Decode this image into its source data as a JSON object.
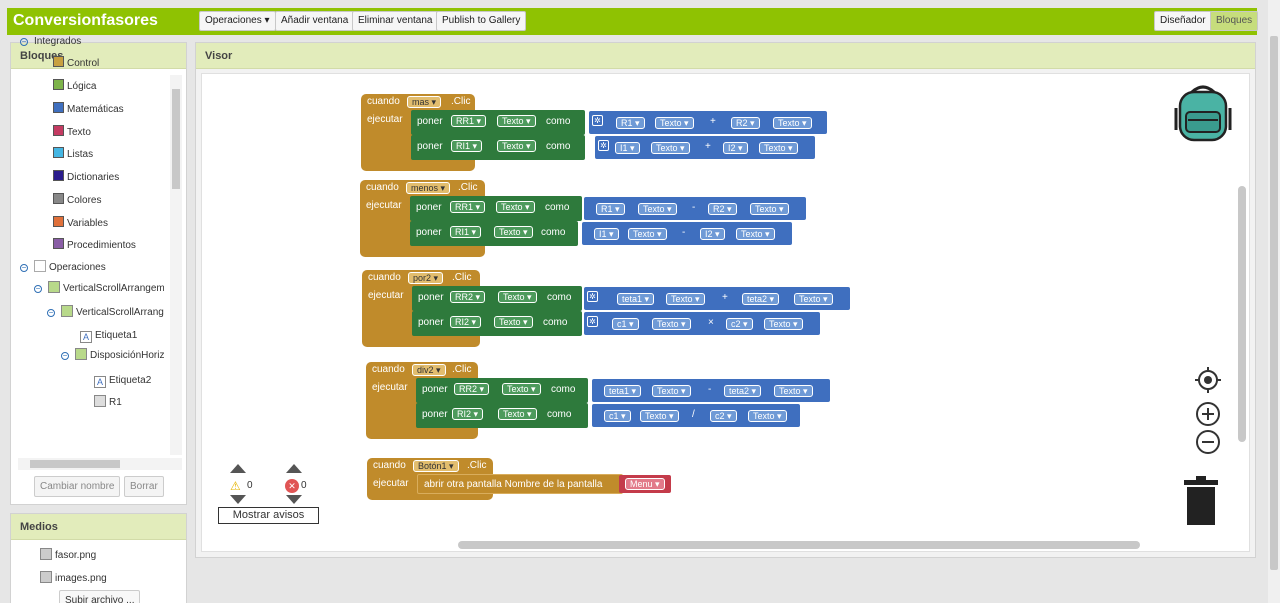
{
  "app": {
    "title": "Conversionfasores"
  },
  "toolbar": {
    "operaciones": "Operaciones ▾",
    "add_window": "Añadir ventana",
    "delete_window": "Eliminar ventana",
    "publish": "Publish to Gallery",
    "designer": "Diseñador",
    "blocks": "Bloques"
  },
  "blocks_panel": {
    "title": "Bloques",
    "tree": [
      {
        "label": "Integrados",
        "kind": "expander"
      },
      {
        "label": "Control",
        "color": "#c8a040"
      },
      {
        "label": "Lógica",
        "color": "#7db34a"
      },
      {
        "label": "Matemáticas",
        "color": "#3f6fbf"
      },
      {
        "label": "Texto",
        "color": "#c43b62"
      },
      {
        "label": "Listas",
        "color": "#44b6e3"
      },
      {
        "label": "Dictionaries",
        "color": "#2a1b8c"
      },
      {
        "label": "Colores",
        "color": "#888888"
      },
      {
        "label": "Variables",
        "color": "#e0703a"
      },
      {
        "label": "Procedimientos",
        "color": "#8a5ea6"
      },
      {
        "label": "Operaciones",
        "kind": "expander"
      },
      {
        "label": "VerticalScrollArrangem",
        "kind": "component"
      },
      {
        "label": "VerticalScrollArrang",
        "kind": "component"
      },
      {
        "label": "Etiqueta1",
        "kind": "component"
      },
      {
        "label": "DisposiciónHoriz",
        "kind": "component"
      },
      {
        "label": "Etiqueta2",
        "kind": "component"
      },
      {
        "label": "R1",
        "kind": "component"
      }
    ],
    "rename_button": "Cambiar nombre",
    "delete_button": "Borrar"
  },
  "media_panel": {
    "title": "Medios",
    "files": [
      "fasor.png",
      "images.png"
    ],
    "upload_button": "Subir archivo ..."
  },
  "viewer": {
    "title": "Visor",
    "warnings_count": "0",
    "errors_count": "0",
    "show_warnings": "Mostrar avisos"
  },
  "blocks": {
    "b1": {
      "when": "cuando",
      "comp": "mas",
      "event": ".Clic",
      "do": "ejecutar",
      "rows": [
        {
          "set": "poner",
          "var": "RR1",
          "prop": "Texto",
          "to": "como",
          "a": "R1",
          "ap": "Texto",
          "op": "+",
          "b": "R2",
          "bp": "Texto"
        },
        {
          "set": "poner",
          "var": "RI1",
          "prop": "Texto",
          "to": "como",
          "a": "I1",
          "ap": "Texto",
          "op": "+",
          "b": "I2",
          "bp": "Texto"
        }
      ]
    },
    "b2": {
      "when": "cuando",
      "comp": "menos",
      "event": ".Clic",
      "do": "ejecutar",
      "rows": [
        {
          "set": "poner",
          "var": "RR1",
          "prop": "Texto",
          "to": "como",
          "a": "R1",
          "ap": "Texto",
          "op": "-",
          "b": "R2",
          "bp": "Texto"
        },
        {
          "set": "poner",
          "var": "RI1",
          "prop": "Texto",
          "to": "como",
          "a": "I1",
          "ap": "Texto",
          "op": "-",
          "b": "I2",
          "bp": "Texto"
        }
      ]
    },
    "b3": {
      "when": "cuando",
      "comp": "por2",
      "event": ".Clic",
      "do": "ejecutar",
      "rows": [
        {
          "set": "poner",
          "var": "RR2",
          "prop": "Texto",
          "to": "como",
          "a": "teta1",
          "ap": "Texto",
          "op": "+",
          "b": "teta2",
          "bp": "Texto"
        },
        {
          "set": "poner",
          "var": "RI2",
          "prop": "Texto",
          "to": "como",
          "a": "c1",
          "ap": "Texto",
          "op": "×",
          "b": "c2",
          "bp": "Texto"
        }
      ]
    },
    "b4": {
      "when": "cuando",
      "comp": "div2",
      "event": ".Clic",
      "do": "ejecutar",
      "rows": [
        {
          "set": "poner",
          "var": "RR2",
          "prop": "Texto",
          "to": "como",
          "a": "teta1",
          "ap": "Texto",
          "op": "-",
          "b": "teta2",
          "bp": "Texto"
        },
        {
          "set": "poner",
          "var": "RI2",
          "prop": "Texto",
          "to": "como",
          "a": "c1",
          "ap": "Texto",
          "op": "/",
          "b": "c2",
          "bp": "Texto"
        }
      ]
    },
    "b5": {
      "when": "cuando",
      "comp": "Botón1",
      "event": ".Clic",
      "do": "ejecutar",
      "open": "abrir otra pantalla  Nombre de la pantalla",
      "screen": "Menu"
    }
  }
}
